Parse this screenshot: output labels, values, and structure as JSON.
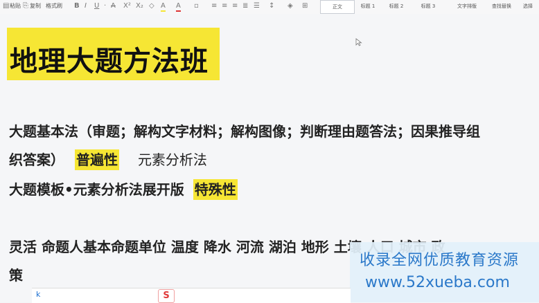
{
  "toolbar": {
    "paste": "粘贴",
    "copy": "复制",
    "format_painter": "格式刷",
    "bold": "B",
    "italic": "I",
    "underline": "U",
    "strikethrough": "A",
    "superscript": "X²",
    "subscript": "X₂",
    "highlight": "A",
    "font_color": "A",
    "styles": [
      "正文",
      "标题 1",
      "标题 2",
      "标题 3"
    ],
    "text_layout": "文字排版",
    "find_replace": "查找替换",
    "select": "选择"
  },
  "document": {
    "title": "地理大题方法班",
    "line1": "大题基本法（审题；解构文字材料；解构图像；判断理由题答法；因果推导组",
    "line2_a": "织答案）",
    "line2_b": "普遍性",
    "line2_c": "元素分析法",
    "line3_a": "大题模板•元素分析法展开版",
    "line3_b": "特殊性",
    "line4": "灵活  命题人基本命题单位   温度  降水  河流  湖泊  地形  土壤  人口  城市  政",
    "line5": "策"
  },
  "watermark": {
    "line1": "收录全网优质教育资源",
    "line2": "www.52xueba.com"
  },
  "ime": {
    "cursor_char": "k",
    "logo": "S"
  },
  "colors": {
    "highlight": "#f6e634",
    "watermark_text": "#2a78c9"
  }
}
